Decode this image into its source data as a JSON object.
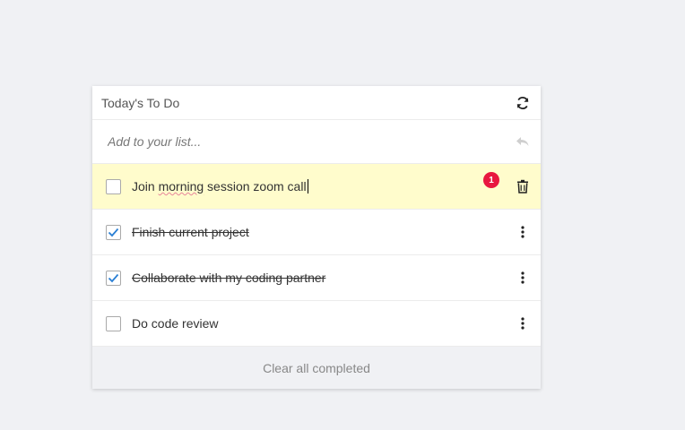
{
  "header": {
    "title": "Today's To Do",
    "refresh_icon": "refresh-icon"
  },
  "add_input": {
    "placeholder": "Add to your list...",
    "undo_icon": "undo-icon"
  },
  "items": [
    {
      "text_before": "Join ",
      "text_misspelled": "morning",
      "text_after": " session zoom call",
      "checked": false,
      "editing": true,
      "badge": "1",
      "action_icon": "trash-icon"
    },
    {
      "text": "Finish current project",
      "checked": true,
      "action_icon": "more-vertical-icon"
    },
    {
      "text": "Collaborate with my coding partner",
      "checked": true,
      "action_icon": "more-vertical-icon"
    },
    {
      "text": "Do code review",
      "checked": false,
      "action_icon": "more-vertical-icon"
    }
  ],
  "footer": {
    "clear_label": "Clear all completed"
  },
  "colors": {
    "editing_bg": "#fffccc",
    "badge": "#e8173f",
    "check": "#2a7fd4",
    "page_bg": "#f0f1f4"
  }
}
